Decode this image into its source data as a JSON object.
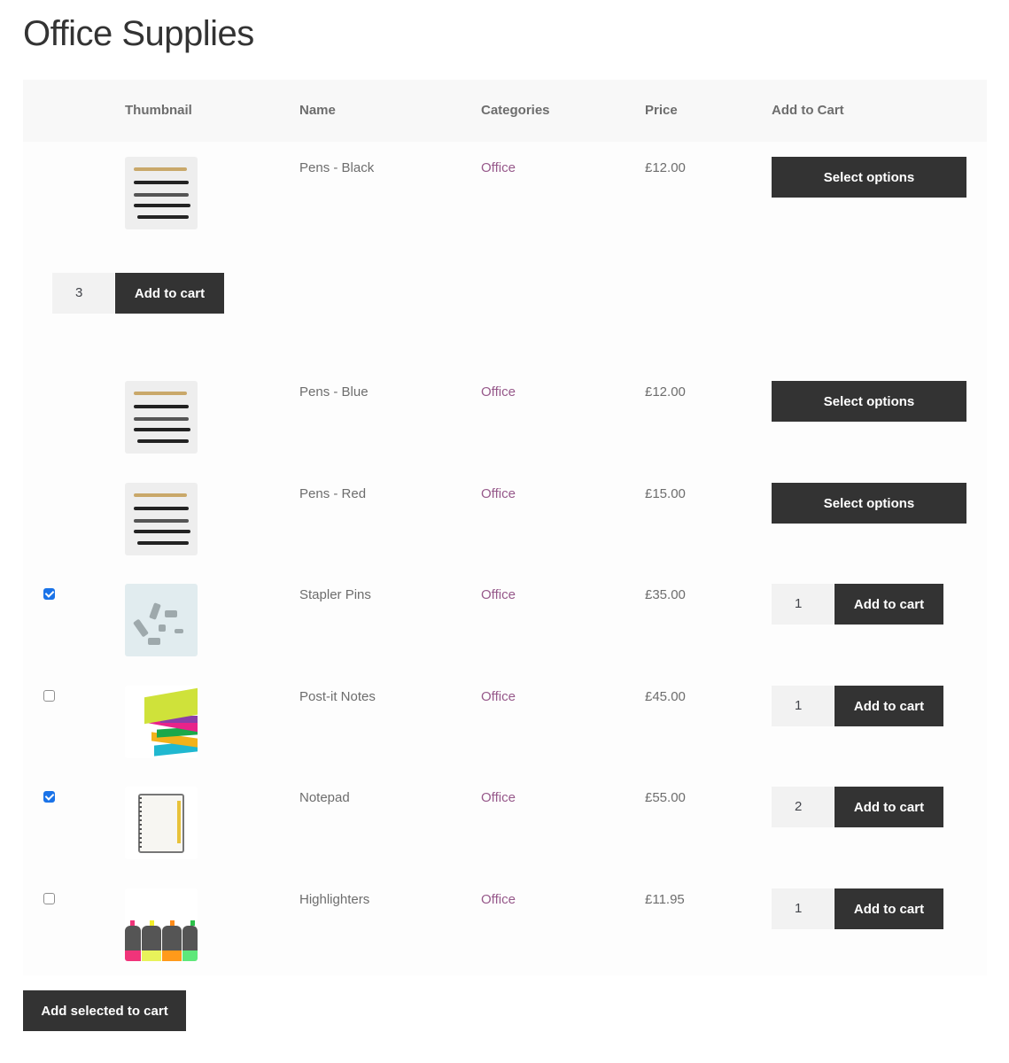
{
  "page": {
    "title": "Office Supplies"
  },
  "table": {
    "headers": [
      "",
      "Thumbnail",
      "Name",
      "Categories",
      "Price",
      "Add to Cart"
    ],
    "rows": [
      {
        "name": "Pens - Black",
        "category": "Office",
        "price": "£12.00",
        "thumbnail": "pens-image",
        "action": "Select options",
        "checkbox": null
      },
      {
        "expanded_variation": true,
        "quantity": "3",
        "action": "Add to cart"
      },
      {
        "name": "Pens - Blue",
        "category": "Office",
        "price": "£12.00",
        "thumbnail": "pens-image",
        "action": "Select options",
        "checkbox": null
      },
      {
        "name": "Pens - Red",
        "category": "Office",
        "price": "£15.00",
        "thumbnail": "pens-image",
        "action": "Select options",
        "checkbox": null
      },
      {
        "name": "Stapler Pins",
        "category": "Office",
        "price": "£35.00",
        "thumbnail": "stapler-pins-image",
        "action": "Add to cart",
        "quantity": "1",
        "checkbox": true
      },
      {
        "name": "Post-it Notes",
        "category": "Office",
        "price": "£45.00",
        "thumbnail": "post-it-notes-image",
        "action": "Add to cart",
        "quantity": "1",
        "checkbox": false
      },
      {
        "name": "Notepad",
        "category": "Office",
        "price": "£55.00",
        "thumbnail": "notepad-image",
        "action": "Add to cart",
        "quantity": "2",
        "checkbox": true
      },
      {
        "name": "Highlighters",
        "category": "Office",
        "price": "£11.95",
        "thumbnail": "highlighters-image",
        "action": "Add to cart",
        "quantity": "1",
        "checkbox": false
      }
    ]
  },
  "footer": {
    "add_selected_label": "Add selected to cart"
  },
  "colors": {
    "button_bg": "#333333",
    "category_link": "#96588a",
    "checkbox_checked": "#1a73e8",
    "header_bg": "#f8f8f8"
  }
}
